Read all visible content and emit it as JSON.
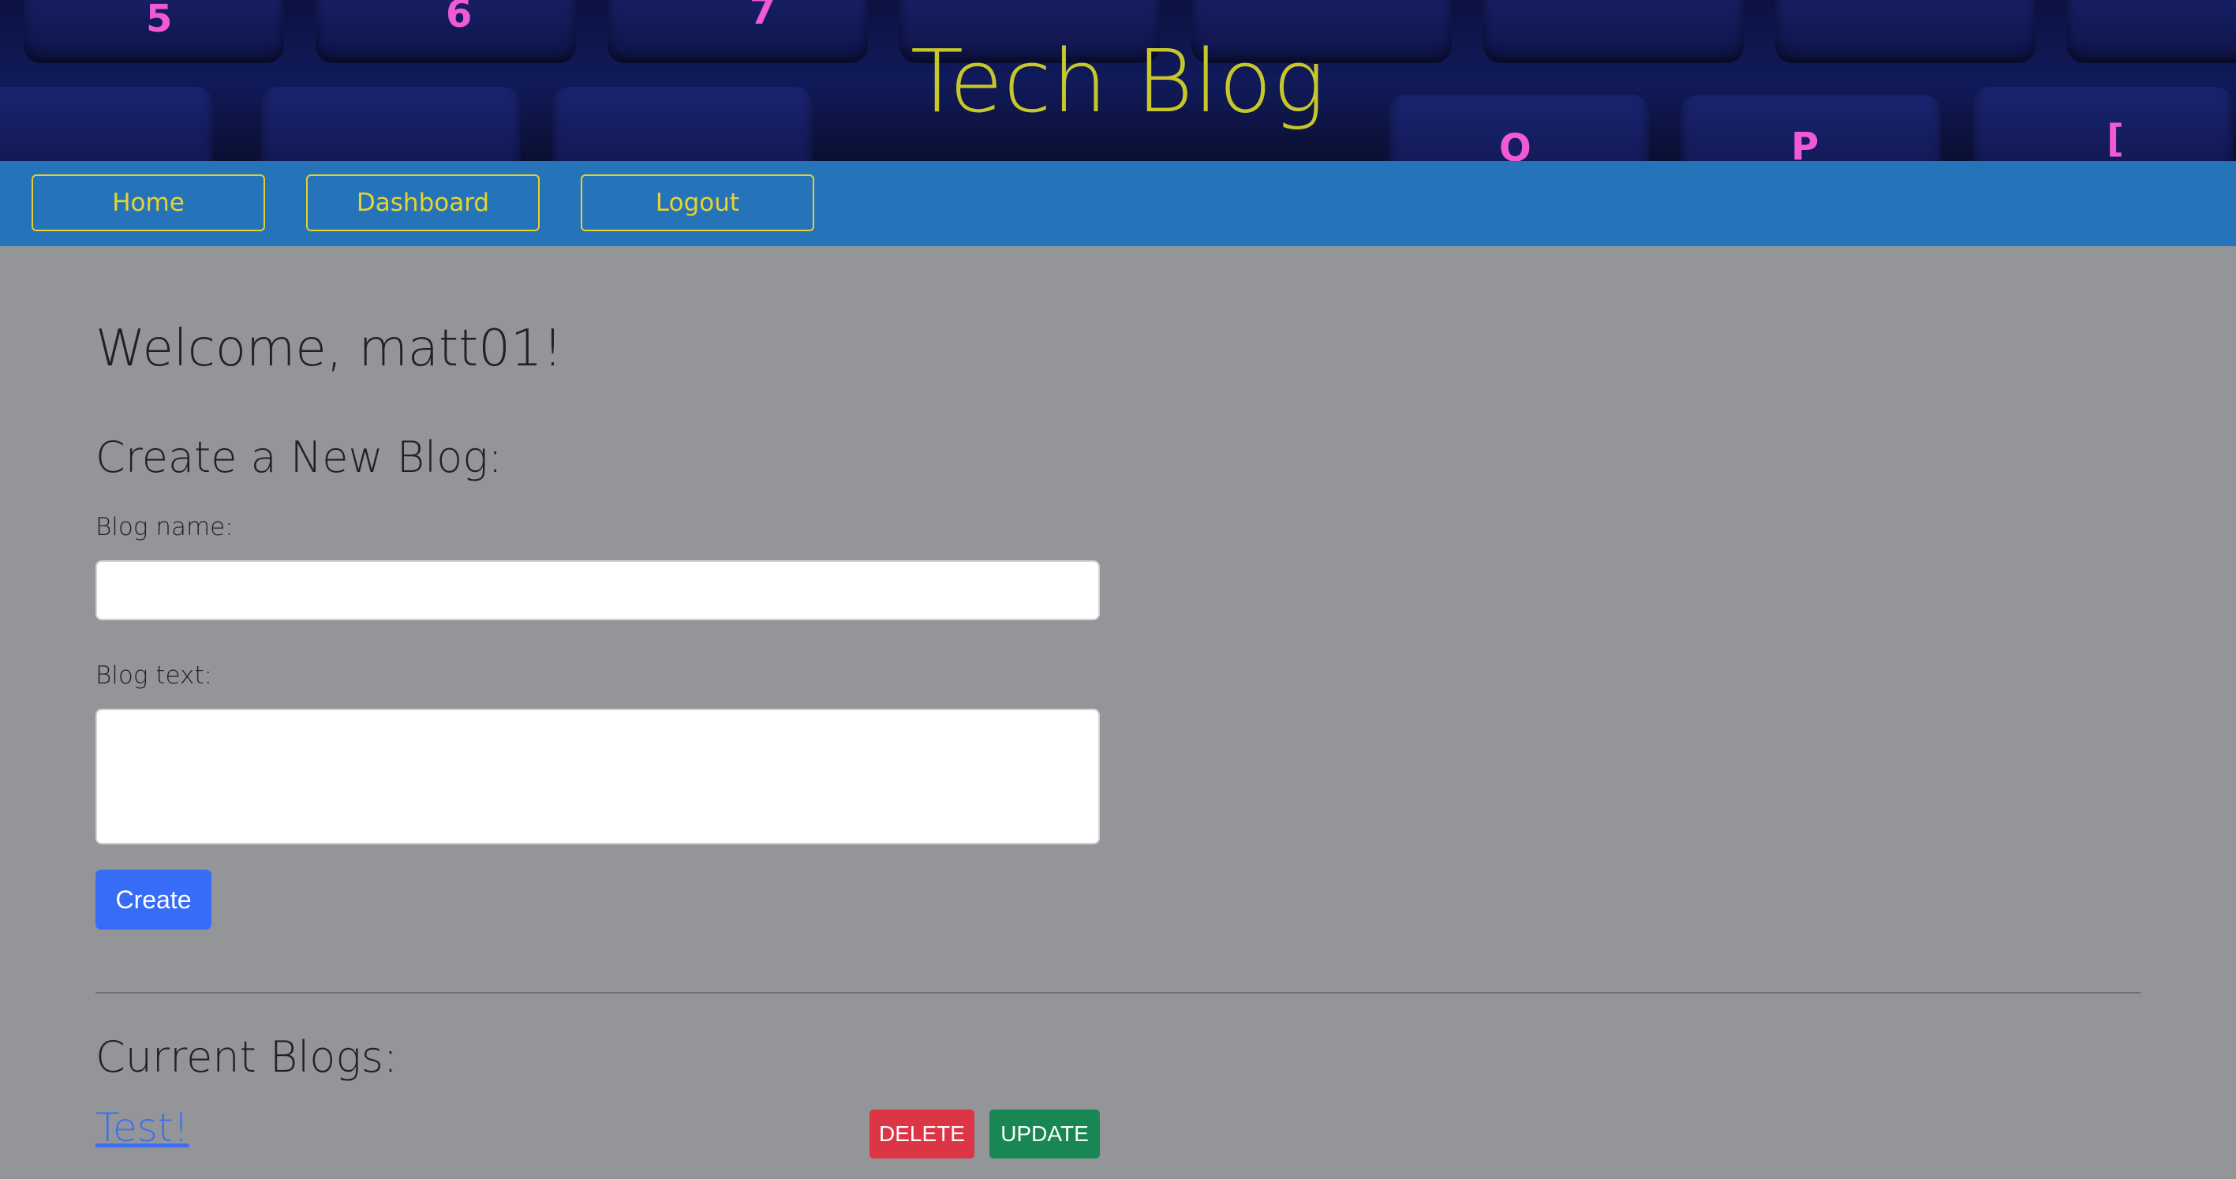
{
  "header": {
    "title": "Tech Blog"
  },
  "nav": {
    "items": [
      {
        "label": "Home"
      },
      {
        "label": "Dashboard"
      },
      {
        "label": "Logout"
      }
    ]
  },
  "main": {
    "welcome": "Welcome, matt01!",
    "create_heading": "Create a New Blog:",
    "blog_name_label": "Blog name:",
    "blog_name_value": "",
    "blog_text_label": "Blog text:",
    "blog_text_value": "",
    "create_button": "Create",
    "current_heading": "Current Blogs:",
    "blogs": [
      {
        "title": "Test!",
        "delete_label": "DELETE",
        "update_label": "UPDATE"
      }
    ]
  },
  "colors": {
    "navbar": "#2574b9",
    "title": "#c7c72c",
    "background": "#939598",
    "create_button": "#366cf6",
    "delete_button": "#dc3545",
    "update_button": "#198754"
  }
}
